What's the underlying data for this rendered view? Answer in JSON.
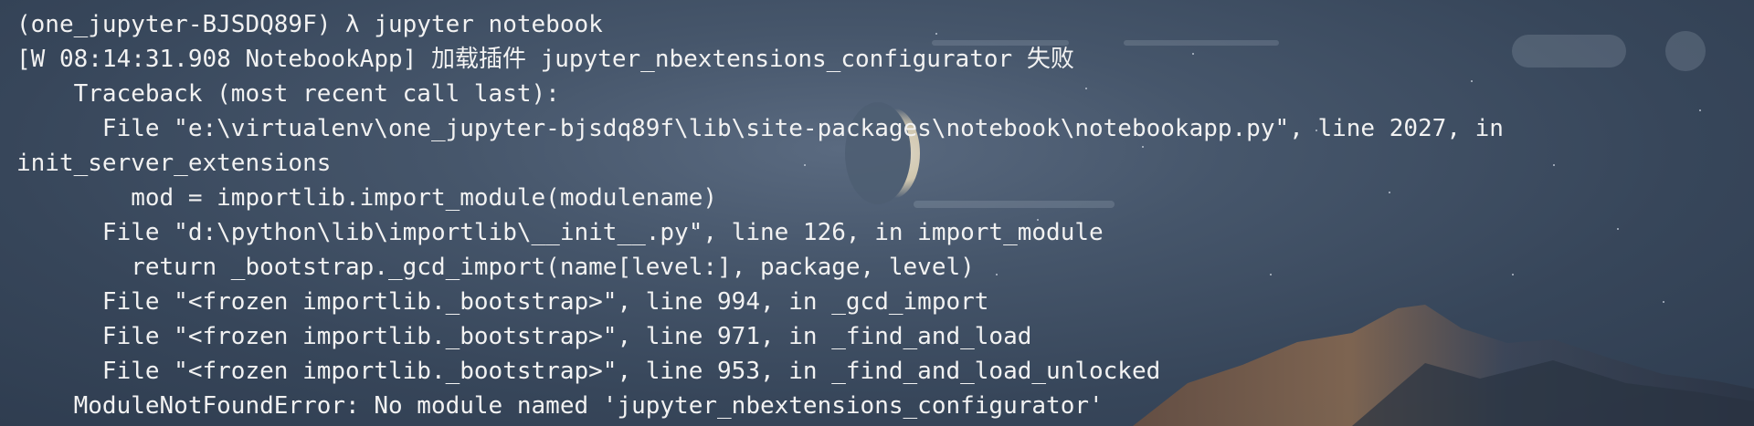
{
  "terminal": {
    "lines": [
      "(one_jupyter-BJSDQ89F) λ jupyter notebook",
      "[W 08:14:31.908 NotebookApp] 加载插件 jupyter_nbextensions_configurator 失败",
      "    Traceback (most recent call last):",
      "      File \"e:\\virtualenv\\one_jupyter-bjsdq89f\\lib\\site-packages\\notebook\\notebookapp.py\", line 2027, in",
      "init_server_extensions",
      "        mod = importlib.import_module(modulename)",
      "      File \"d:\\python\\lib\\importlib\\__init__.py\", line 126, in import_module",
      "        return _bootstrap._gcd_import(name[level:], package, level)",
      "      File \"<frozen importlib._bootstrap>\", line 994, in _gcd_import",
      "      File \"<frozen importlib._bootstrap>\", line 971, in _find_and_load",
      "      File \"<frozen importlib._bootstrap>\", line 953, in _find_and_load_unlocked",
      "    ModuleNotFoundError: No module named 'jupyter_nbextensions_configurator'"
    ]
  }
}
